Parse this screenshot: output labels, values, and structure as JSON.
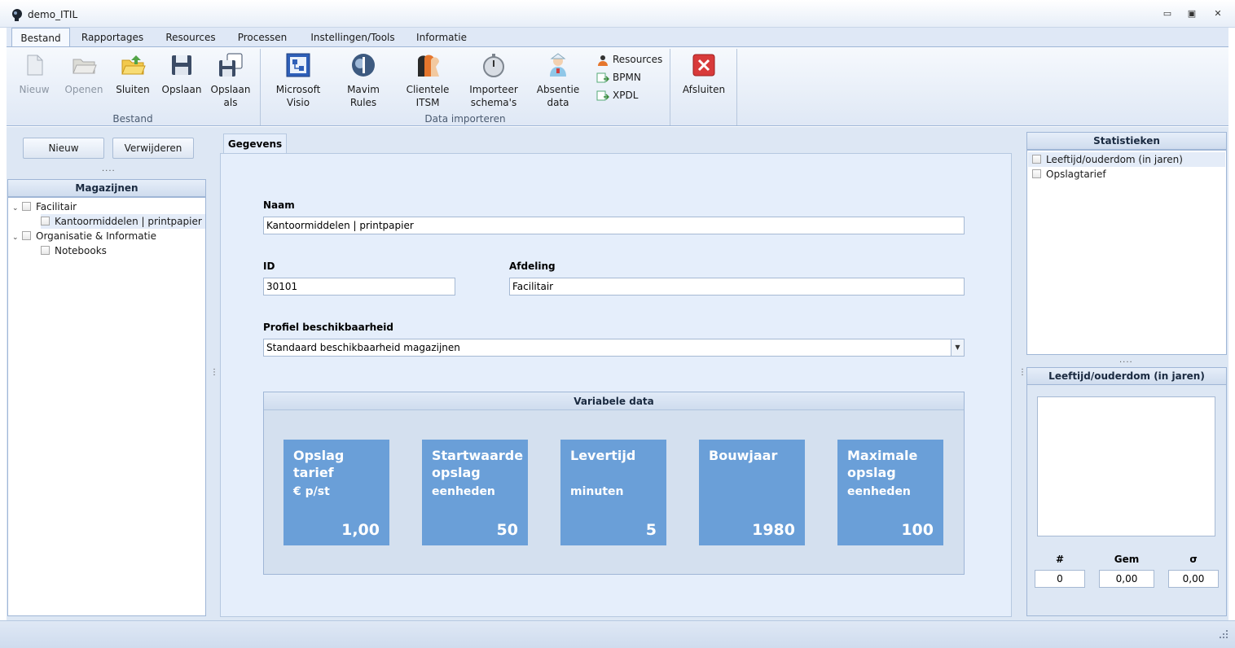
{
  "window": {
    "title": "demo_ITIL",
    "minimize": "▭",
    "restore": "▣",
    "close": "✕"
  },
  "menu": {
    "tabs": [
      "Bestand",
      "Rapportages",
      "Resources",
      "Processen",
      "Instellingen/Tools",
      "Informatie"
    ],
    "active": "Bestand"
  },
  "ribbon": {
    "bestand": {
      "group_label": "Bestand",
      "nieuw": "Nieuw",
      "openen": "Openen",
      "sluiten": "Sluiten",
      "opslaan": "Opslaan",
      "opslaan_als_1": "Opslaan",
      "opslaan_als_2": "als"
    },
    "import": {
      "group_label": "Data importeren",
      "visio_1": "Microsoft",
      "visio_2": "Visio",
      "mavim_1": "Mavim",
      "mavim_2": "Rules",
      "clientele_1": "Clientele",
      "clientele_2": "ITSM",
      "importeer_1": "Importeer",
      "importeer_2": "schema's",
      "absentie_1": "Absentie",
      "absentie_2": "data",
      "resources": "Resources",
      "bpmn": "BPMN",
      "xpdl": "XPDL"
    },
    "afsluiten": "Afsluiten"
  },
  "left": {
    "new_button": "Nieuw",
    "delete_button": "Verwijderen",
    "panel_title": "Magazijnen",
    "tree": [
      {
        "label": "Facilitair"
      },
      {
        "label": "Kantoormiddelen | printpapier",
        "selected": true
      },
      {
        "label": "Organisatie & Informatie"
      },
      {
        "label": "Notebooks"
      }
    ]
  },
  "center": {
    "tab": "Gegevens",
    "naam_label": "Naam",
    "naam_value": "Kantoormiddelen | printpapier",
    "id_label": "ID",
    "id_value": "30101",
    "afdeling_label": "Afdeling",
    "afdeling_value": "Facilitair",
    "profiel_label": "Profiel beschikbaarheid",
    "profiel_value": "Standaard beschikbaarheid magazijnen",
    "variabele_title": "Variabele data",
    "tiles": [
      {
        "title": "Opslag tarief",
        "unit": "€ p/st",
        "value": "1,00"
      },
      {
        "title": "Startwaarde opslag",
        "unit": "eenheden",
        "value": "50"
      },
      {
        "title": "Levertijd",
        "unit": "minuten",
        "value": "5"
      },
      {
        "title": "Bouwjaar",
        "unit": "",
        "value": "1980"
      },
      {
        "title": "Maximale opslag",
        "unit": "eenheden",
        "value": "100"
      }
    ]
  },
  "right": {
    "stats_title": "Statistieken",
    "stats_items": [
      "Leeftijd/ouderdom (in jaren)",
      "Opslagtarief"
    ],
    "detail_title": "Leeftijd/ouderdom (in jaren)",
    "count_label": "#",
    "count_value": "0",
    "avg_label": "Gem",
    "avg_value": "0,00",
    "sigma_label": "σ",
    "sigma_value": "0,00"
  },
  "grips": {
    "dots": "....",
    "vdots": "⋮"
  }
}
